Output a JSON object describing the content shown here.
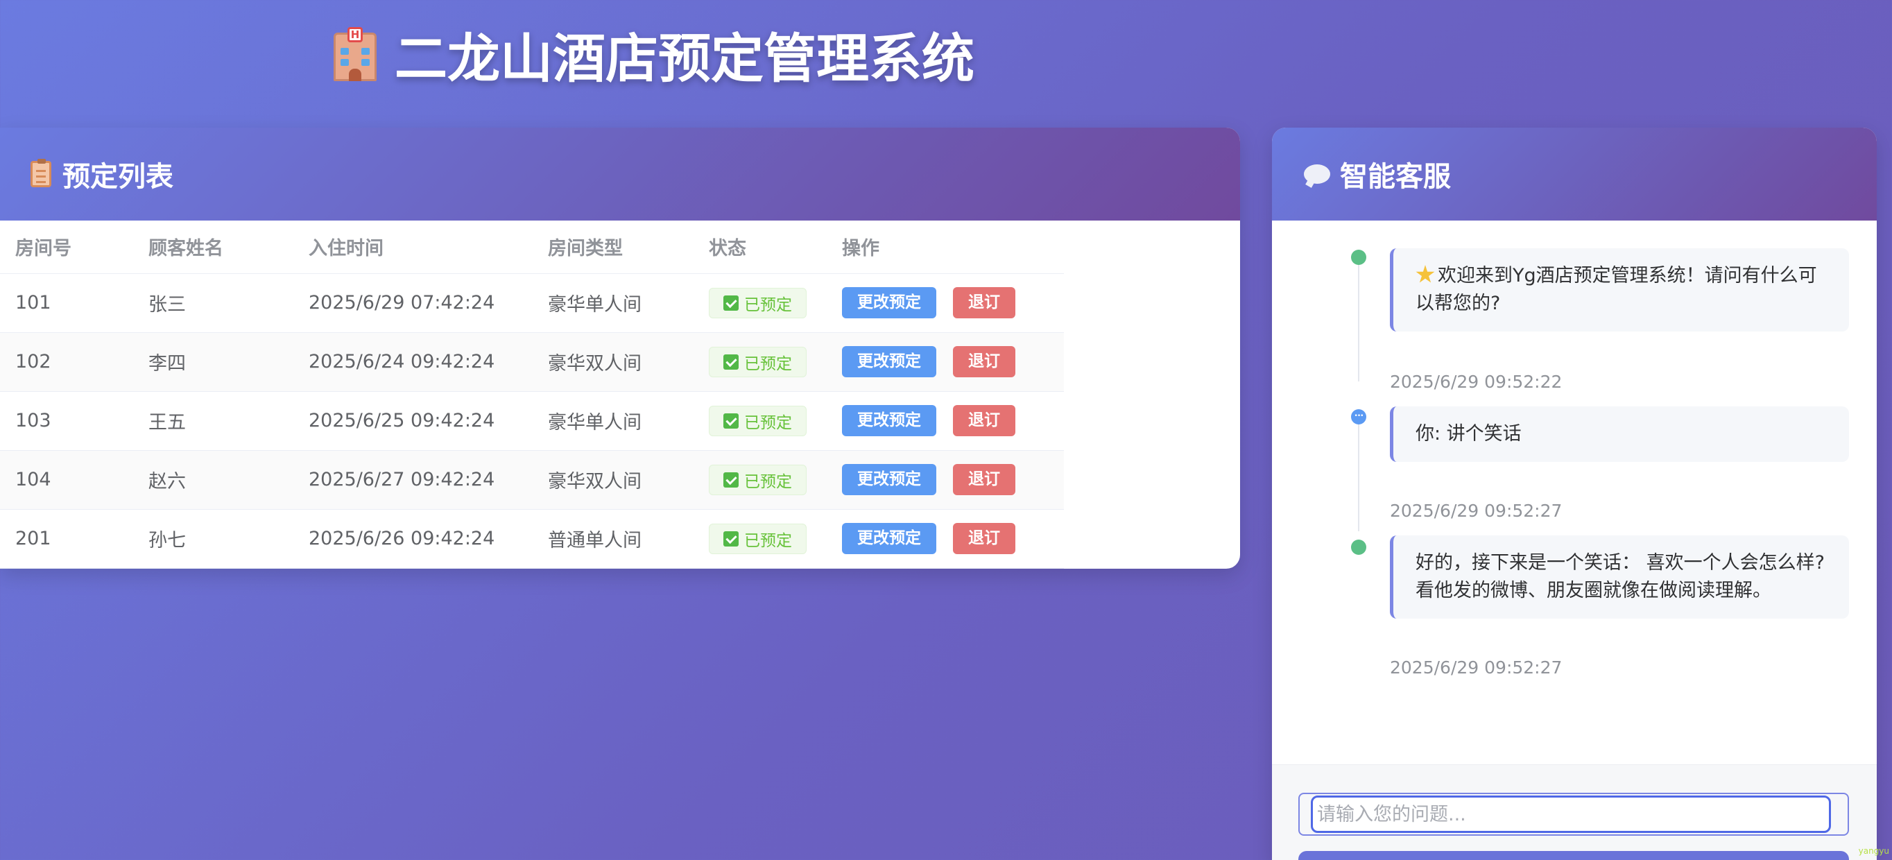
{
  "page_title": "二龙山酒店预定管理系统",
  "booking_panel": {
    "title": "预定列表",
    "columns": [
      "房间号",
      "顾客姓名",
      "入住时间",
      "房间类型",
      "状态",
      "操作"
    ],
    "rows": [
      {
        "room": "101",
        "name": "张三",
        "checkin": "2025/6/29 07:42:24",
        "type": "豪华单人间",
        "status": "已预定"
      },
      {
        "room": "102",
        "name": "李四",
        "checkin": "2025/6/24 09:42:24",
        "type": "豪华双人间",
        "status": "已预定"
      },
      {
        "room": "103",
        "name": "王五",
        "checkin": "2025/6/25 09:42:24",
        "type": "豪华单人间",
        "status": "已预定"
      },
      {
        "room": "104",
        "name": "赵六",
        "checkin": "2025/6/27 09:42:24",
        "type": "豪华双人间",
        "status": "已预定"
      },
      {
        "room": "201",
        "name": "孙七",
        "checkin": "2025/6/26 09:42:24",
        "type": "普通单人间",
        "status": "已预定"
      }
    ],
    "edit_label": "更改预定",
    "cancel_label": "退订"
  },
  "chat": {
    "title": "智能客服",
    "messages": [
      {
        "text": "欢迎来到Yg酒店预定管理系统！请问有什么可以帮您的?",
        "time": "2025/6/29 09:52:22",
        "sender": "bot"
      },
      {
        "text": "你: 讲个笑话",
        "time": "2025/6/29 09:52:27",
        "sender": "user"
      },
      {
        "text": "好的，接下来是一个笑话： 喜欢一个人会怎么样? 看他发的微博、朋友圈就像在做阅读理解。",
        "time": "2025/6/29 09:52:27",
        "sender": "bot"
      }
    ],
    "input_placeholder": "请输入您的问题..."
  },
  "watermark": "yangyu",
  "colors": {
    "accent": "#6b7be0",
    "edit_button": "#5b9af3",
    "cancel_button": "#e57272",
    "status_green": "#67c23a"
  }
}
